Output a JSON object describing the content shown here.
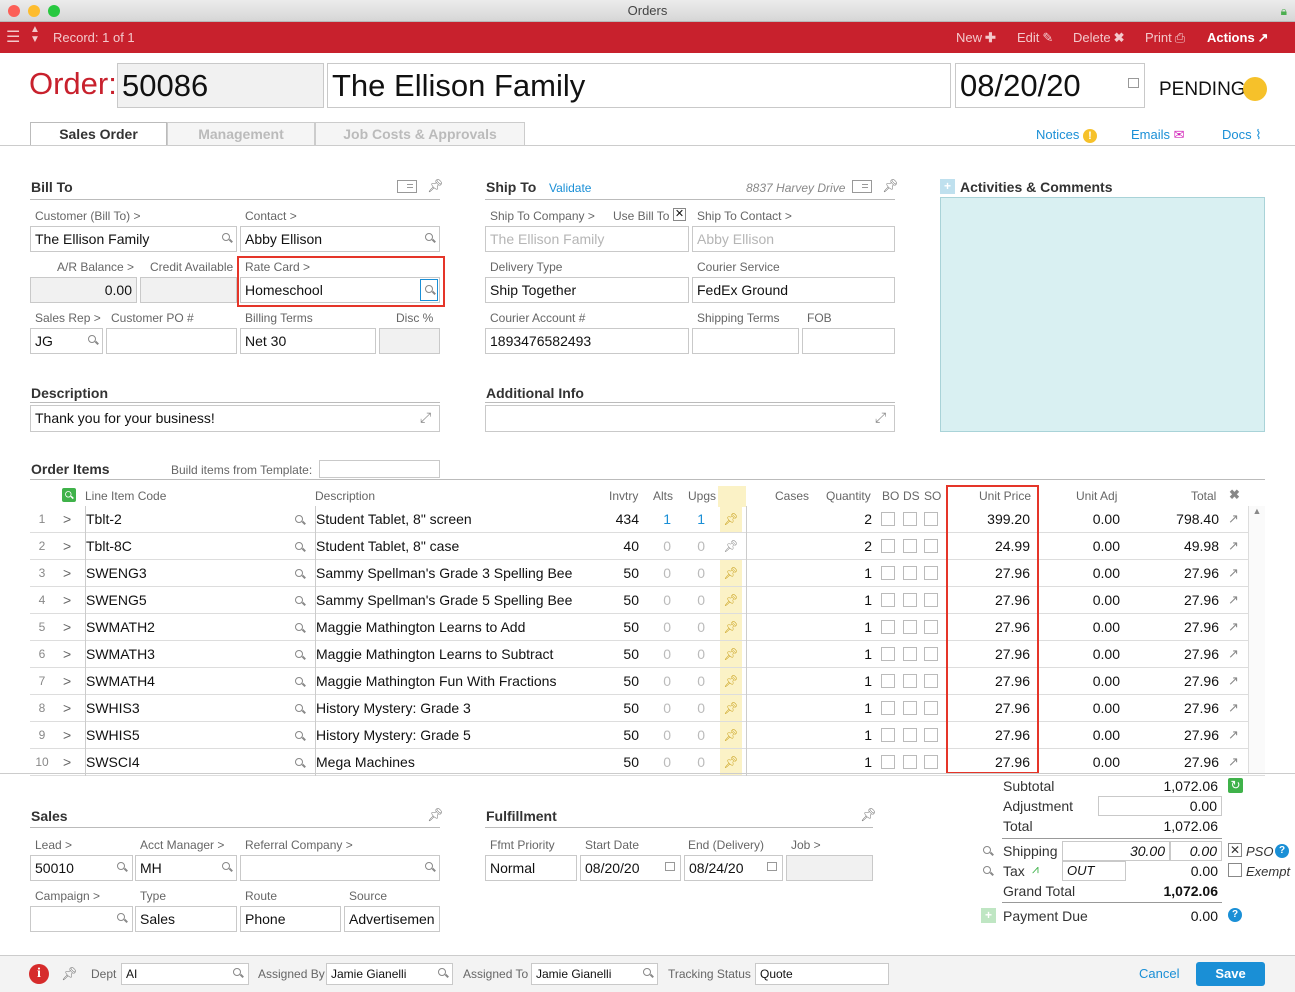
{
  "window": {
    "title": "Orders"
  },
  "toolbar": {
    "record": "Record: 1 of 1",
    "new": "New",
    "edit": "Edit",
    "delete": "Delete",
    "print": "Print",
    "actions": "Actions"
  },
  "header": {
    "order_label": "Order:",
    "order_number": "50086",
    "customer_name": "The Ellison Family",
    "date": "08/20/20",
    "status": "PENDING"
  },
  "tabs": [
    "Sales Order",
    "Management",
    "Job Costs & Approvals"
  ],
  "links": {
    "notices": "Notices",
    "emails": "Emails",
    "docs": "Docs"
  },
  "bill_to": {
    "title": "Bill To",
    "customer_label": "Customer (Bill To) >",
    "customer": "The Ellison Family",
    "contact_label": "Contact >",
    "contact": "Abby Ellison",
    "ar_label": "A/R Balance >",
    "ar": "0.00",
    "credit_label": "Credit Available",
    "credit": "",
    "rate_label": "Rate Card >",
    "rate": "Homeschool",
    "rep_label": "Sales Rep >",
    "rep": "JG",
    "po_label": "Customer PO #",
    "po": "",
    "terms_label": "Billing Terms",
    "terms": "Net 30",
    "disc_label": "Disc %",
    "disc": ""
  },
  "ship_to": {
    "title": "Ship To",
    "validate": "Validate",
    "address": "8837 Harvey Drive",
    "company_label": "Ship To Company >",
    "use_bill_label": "Use Bill To",
    "contact_label": "Ship To Contact >",
    "company": "The Ellison Family",
    "contact": "Abby Ellison",
    "delivery_label": "Delivery Type",
    "delivery": "Ship Together",
    "courier_label": "Courier Service",
    "courier": "FedEx Ground",
    "account_label": "Courier Account #",
    "account": "1893476582493",
    "terms_label": "Shipping Terms",
    "terms": "",
    "fob_label": "FOB",
    "fob": ""
  },
  "activities": {
    "title": "Activities & Comments"
  },
  "description": {
    "title": "Description",
    "value": "Thank you for your business!"
  },
  "additional": {
    "title": "Additional Info",
    "value": ""
  },
  "order_items": {
    "title": "Order Items",
    "template_label": "Build items from Template:",
    "headers": {
      "code": "Line Item Code",
      "desc": "Description",
      "inv": "Invtry",
      "alts": "Alts",
      "upgs": "Upgs",
      "cases": "Cases",
      "qty": "Quantity",
      "bo": "BO",
      "ds": "DS",
      "so": "SO",
      "price": "Unit Price",
      "adj": "Unit Adj",
      "total": "Total"
    },
    "rows": [
      {
        "n": "1",
        "code": "Tblt-2",
        "desc": "Student Tablet, 8\" screen",
        "inv": "434",
        "alts": "1",
        "upgs": "1",
        "qty": "2",
        "price": "399.20",
        "adj": "0.00",
        "total": "798.40"
      },
      {
        "n": "2",
        "code": "Tblt-8C",
        "desc": "  Student Tablet, 8\" case",
        "inv": "40",
        "alts": "0",
        "upgs": "0",
        "qty": "2",
        "price": "24.99",
        "adj": "0.00",
        "total": "49.98"
      },
      {
        "n": "3",
        "code": "SWENG3",
        "desc": "Sammy Spellman's Grade 3 Spelling Bee",
        "inv": "50",
        "alts": "0",
        "upgs": "0",
        "qty": "1",
        "price": "27.96",
        "adj": "0.00",
        "total": "27.96"
      },
      {
        "n": "4",
        "code": "SWENG5",
        "desc": "Sammy Spellman's Grade 5 Spelling Bee",
        "inv": "50",
        "alts": "0",
        "upgs": "0",
        "qty": "1",
        "price": "27.96",
        "adj": "0.00",
        "total": "27.96"
      },
      {
        "n": "5",
        "code": "SWMATH2",
        "desc": "Maggie Mathington Learns to Add",
        "inv": "50",
        "alts": "0",
        "upgs": "0",
        "qty": "1",
        "price": "27.96",
        "adj": "0.00",
        "total": "27.96"
      },
      {
        "n": "6",
        "code": "SWMATH3",
        "desc": "Maggie Mathington Learns to Subtract",
        "inv": "50",
        "alts": "0",
        "upgs": "0",
        "qty": "1",
        "price": "27.96",
        "adj": "0.00",
        "total": "27.96"
      },
      {
        "n": "7",
        "code": "SWMATH4",
        "desc": "Maggie Mathington Fun With Fractions",
        "inv": "50",
        "alts": "0",
        "upgs": "0",
        "qty": "1",
        "price": "27.96",
        "adj": "0.00",
        "total": "27.96"
      },
      {
        "n": "8",
        "code": "SWHIS3",
        "desc": "History Mystery: Grade 3",
        "inv": "50",
        "alts": "0",
        "upgs": "0",
        "qty": "1",
        "price": "27.96",
        "adj": "0.00",
        "total": "27.96"
      },
      {
        "n": "9",
        "code": "SWHIS5",
        "desc": "History Mystery: Grade 5",
        "inv": "50",
        "alts": "0",
        "upgs": "0",
        "qty": "1",
        "price": "27.96",
        "adj": "0.00",
        "total": "27.96"
      },
      {
        "n": "10",
        "code": "SWSCI4",
        "desc": "Mega Machines",
        "inv": "50",
        "alts": "0",
        "upgs": "0",
        "qty": "1",
        "price": "27.96",
        "adj": "0.00",
        "total": "27.96"
      }
    ]
  },
  "sales": {
    "title": "Sales",
    "lead_label": "Lead >",
    "lead": "50010",
    "acct_label": "Acct Manager >",
    "acct": "MH",
    "referral_label": "Referral Company >",
    "referral": "",
    "campaign_label": "Campaign >",
    "campaign": "",
    "type_label": "Type",
    "type": "Sales",
    "route_label": "Route",
    "route": "Phone",
    "source_label": "Source",
    "source": "Advertisemen"
  },
  "fulfillment": {
    "title": "Fulfillment",
    "priority_label": "Ffmt Priority",
    "priority": "Normal",
    "start_label": "Start Date",
    "start": "08/20/20",
    "end_label": "End (Delivery)",
    "end": "08/24/20",
    "job_label": "Job >",
    "job": ""
  },
  "totals": {
    "subtotal_label": "Subtotal",
    "subtotal": "1,072.06",
    "adjustment_label": "Adjustment",
    "adjustment": "0.00",
    "total_label": "Total",
    "total": "1,072.06",
    "shipping_label": "Shipping",
    "shipping_est": "30.00",
    "shipping": "0.00",
    "pso": "PSO",
    "tax_label": "Tax",
    "tax_code": "OUT",
    "tax": "0.00",
    "exempt": "Exempt",
    "grand_label": "Grand Total",
    "grand": "1,072.06",
    "due_label": "Payment Due",
    "due": "0.00"
  },
  "footer": {
    "dept_label": "Dept",
    "dept": "AI",
    "assigned_by_label": "Assigned By",
    "assigned_by": "Jamie Gianelli",
    "assigned_to_label": "Assigned To",
    "assigned_to": "Jamie Gianelli",
    "tracking_label": "Tracking Status",
    "tracking": "Quote",
    "cancel": "Cancel",
    "save": "Save"
  },
  "colors": {
    "toolbar": "#c8212d",
    "accent": "#1a8fd6",
    "highlight": "#e53529"
  }
}
